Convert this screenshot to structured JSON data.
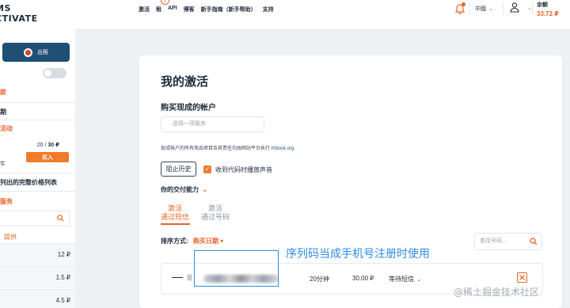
{
  "sidebar": {
    "logo_line1": "MS",
    "logo_line2": "CTIVATE",
    "rent_label": "出租",
    "links": [
      "款",
      "期",
      "活动",
      "列出的完整价格列表",
      "服务"
    ],
    "counter_current": "20 / ",
    "counter_total": "30 ₽",
    "buy_label": "买入",
    "small_text": "牛",
    "sub_link": "提供",
    "prices": [
      "12 ₽",
      "1.5 ₽",
      "4.5 ₽"
    ]
  },
  "header": {
    "nav": [
      "激活",
      "租",
      "API",
      "博客",
      "新手指南（新手帮助）",
      "支持"
    ],
    "notification_count": "1",
    "language": "中國",
    "balance_label": "余额",
    "balance_value": "33.72 ₽"
  },
  "main": {
    "title": "我的激活",
    "section_title": "购买现成的帐户",
    "service_placeholder": "选择一项服务",
    "note": "现成帐户的所有商品项目及其责任均由网站平台执行 ",
    "note_link": "hStock.org",
    "history_label": "阻止历史",
    "sound_label": "收到代码时播放声音",
    "delivery_label": "你的交付能力",
    "tabs": [
      {
        "line1": "激活",
        "line2": "通过短信"
      },
      {
        "line1": "激活",
        "line2": "通过号码"
      }
    ],
    "sort_label": "排序方式:",
    "sort_value": "购买日期",
    "search_placeholder": "查找号码...",
    "row": {
      "duration": "20分钟",
      "price": "30.00 ₽",
      "status": "等待短信"
    }
  },
  "overlay": {
    "annotation": "序列码当成手机号注册时使用",
    "watermark": "@稀土掘金技术社区"
  },
  "colors": {
    "accent": "#e8632a",
    "primary": "#1f4f73",
    "annotation": "#2d8be6"
  }
}
